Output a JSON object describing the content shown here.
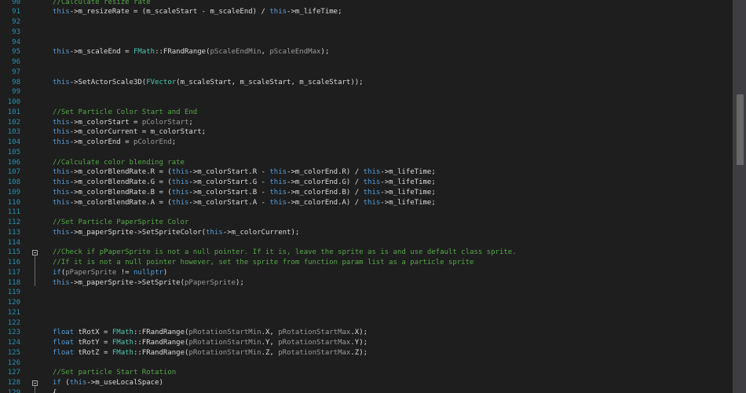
{
  "colors": {
    "background": "#1e1e1e",
    "line_number": "#2b91af",
    "comment": "#57a64a",
    "keyword": "#569cd6",
    "member": "#dcdcdc",
    "class": "#4ec9b0",
    "function": "#dcdcaa",
    "param": "#9a9a9a",
    "default": "#dcdcdc"
  },
  "editor": {
    "lines": [
      {
        "n": "90",
        "tokens": [
          {
            "t": "//Calculate resize rate",
            "c": "comment"
          }
        ]
      },
      {
        "n": "91",
        "tokens": [
          {
            "t": "this",
            "c": "keyword"
          },
          {
            "t": "->m_resizeRate = (m_scaleStart - m_scaleEnd) / ",
            "c": "default"
          },
          {
            "t": "this",
            "c": "keyword"
          },
          {
            "t": "->m_lifeTime;",
            "c": "default"
          }
        ]
      },
      {
        "n": "92",
        "tokens": []
      },
      {
        "n": "93",
        "tokens": []
      },
      {
        "n": "94",
        "tokens": []
      },
      {
        "n": "95",
        "tokens": [
          {
            "t": "this",
            "c": "keyword"
          },
          {
            "t": "->m_scaleEnd = ",
            "c": "default"
          },
          {
            "t": "FMath",
            "c": "class"
          },
          {
            "t": "::FRandRange(",
            "c": "default"
          },
          {
            "t": "pScaleEndMin",
            "c": "param"
          },
          {
            "t": ", ",
            "c": "default"
          },
          {
            "t": "pScaleEndMax",
            "c": "param"
          },
          {
            "t": ");",
            "c": "default"
          }
        ]
      },
      {
        "n": "96",
        "tokens": []
      },
      {
        "n": "97",
        "tokens": []
      },
      {
        "n": "98",
        "tokens": [
          {
            "t": "this",
            "c": "keyword"
          },
          {
            "t": "->SetActorScale3D(",
            "c": "default"
          },
          {
            "t": "FVector",
            "c": "class"
          },
          {
            "t": "(m_scaleStart, m_scaleStart, m_scaleStart));",
            "c": "default"
          }
        ]
      },
      {
        "n": "99",
        "tokens": []
      },
      {
        "n": "100",
        "tokens": []
      },
      {
        "n": "101",
        "tokens": [
          {
            "t": "//Set Particle Color Start and End",
            "c": "comment"
          }
        ]
      },
      {
        "n": "102",
        "tokens": [
          {
            "t": "this",
            "c": "keyword"
          },
          {
            "t": "->m_colorStart = ",
            "c": "default"
          },
          {
            "t": "pColorStart",
            "c": "param"
          },
          {
            "t": ";",
            "c": "default"
          }
        ]
      },
      {
        "n": "103",
        "tokens": [
          {
            "t": "this",
            "c": "keyword"
          },
          {
            "t": "->m_colorCurrent = m_colorStart;",
            "c": "default"
          }
        ]
      },
      {
        "n": "104",
        "tokens": [
          {
            "t": "this",
            "c": "keyword"
          },
          {
            "t": "->m_colorEnd = ",
            "c": "default"
          },
          {
            "t": "pColorEnd",
            "c": "param"
          },
          {
            "t": ";",
            "c": "default"
          }
        ]
      },
      {
        "n": "105",
        "tokens": []
      },
      {
        "n": "106",
        "tokens": [
          {
            "t": "//Calculate color blending rate",
            "c": "comment"
          }
        ]
      },
      {
        "n": "107",
        "tokens": [
          {
            "t": "this",
            "c": "keyword"
          },
          {
            "t": "->m_colorBlendRate.R = (",
            "c": "default"
          },
          {
            "t": "this",
            "c": "keyword"
          },
          {
            "t": "->m_colorStart.R - ",
            "c": "default"
          },
          {
            "t": "this",
            "c": "keyword"
          },
          {
            "t": "->m_colorEnd.R) / ",
            "c": "default"
          },
          {
            "t": "this",
            "c": "keyword"
          },
          {
            "t": "->m_lifeTime;",
            "c": "default"
          }
        ]
      },
      {
        "n": "108",
        "tokens": [
          {
            "t": "this",
            "c": "keyword"
          },
          {
            "t": "->m_colorBlendRate.G = (",
            "c": "default"
          },
          {
            "t": "this",
            "c": "keyword"
          },
          {
            "t": "->m_colorStart.G - ",
            "c": "default"
          },
          {
            "t": "this",
            "c": "keyword"
          },
          {
            "t": "->m_colorEnd.G) / ",
            "c": "default"
          },
          {
            "t": "this",
            "c": "keyword"
          },
          {
            "t": "->m_lifeTime;",
            "c": "default"
          }
        ]
      },
      {
        "n": "109",
        "tokens": [
          {
            "t": "this",
            "c": "keyword"
          },
          {
            "t": "->m_colorBlendRate.B = (",
            "c": "default"
          },
          {
            "t": "this",
            "c": "keyword"
          },
          {
            "t": "->m_colorStart.B - ",
            "c": "default"
          },
          {
            "t": "this",
            "c": "keyword"
          },
          {
            "t": "->m_colorEnd.B) / ",
            "c": "default"
          },
          {
            "t": "this",
            "c": "keyword"
          },
          {
            "t": "->m_lifeTime;",
            "c": "default"
          }
        ]
      },
      {
        "n": "110",
        "tokens": [
          {
            "t": "this",
            "c": "keyword"
          },
          {
            "t": "->m_colorBlendRate.A = (",
            "c": "default"
          },
          {
            "t": "this",
            "c": "keyword"
          },
          {
            "t": "->m_colorStart.A - ",
            "c": "default"
          },
          {
            "t": "this",
            "c": "keyword"
          },
          {
            "t": "->m_colorEnd.A) / ",
            "c": "default"
          },
          {
            "t": "this",
            "c": "keyword"
          },
          {
            "t": "->m_lifeTime;",
            "c": "default"
          }
        ]
      },
      {
        "n": "111",
        "tokens": []
      },
      {
        "n": "112",
        "tokens": [
          {
            "t": "//Set Particle PaperSprite Color",
            "c": "comment"
          }
        ]
      },
      {
        "n": "113",
        "tokens": [
          {
            "t": "this",
            "c": "keyword"
          },
          {
            "t": "->m_paperSprite->SetSpriteColor(",
            "c": "default"
          },
          {
            "t": "this",
            "c": "keyword"
          },
          {
            "t": "->m_colorCurrent);",
            "c": "default"
          }
        ]
      },
      {
        "n": "114",
        "tokens": []
      },
      {
        "n": "115",
        "tokens": [
          {
            "t": "//Check if pPaperSprite is not a null pointer. If it is, leave the sprite as is and use default class sprite.",
            "c": "comment"
          }
        ]
      },
      {
        "n": "116",
        "tokens": [
          {
            "t": "//If it is not a null pointer however, set the sprite from function param list as a particle sprite",
            "c": "comment"
          }
        ]
      },
      {
        "n": "117",
        "tokens": [
          {
            "t": "if",
            "c": "keyword"
          },
          {
            "t": "(",
            "c": "default"
          },
          {
            "t": "pPaperSprite",
            "c": "param"
          },
          {
            "t": " != ",
            "c": "default"
          },
          {
            "t": "nullptr",
            "c": "keyword"
          },
          {
            "t": ")",
            "c": "default"
          }
        ]
      },
      {
        "n": "118",
        "tokens": [
          {
            "t": "this",
            "c": "keyword"
          },
          {
            "t": "->m_paperSprite->SetSprite(",
            "c": "default"
          },
          {
            "t": "pPaperSprite",
            "c": "param"
          },
          {
            "t": ");",
            "c": "default"
          }
        ]
      },
      {
        "n": "119",
        "tokens": []
      },
      {
        "n": "120",
        "tokens": []
      },
      {
        "n": "121",
        "tokens": []
      },
      {
        "n": "122",
        "tokens": []
      },
      {
        "n": "123",
        "tokens": [
          {
            "t": "float",
            "c": "keyword"
          },
          {
            "t": " tRotX = ",
            "c": "default"
          },
          {
            "t": "FMath",
            "c": "class"
          },
          {
            "t": "::FRandRange(",
            "c": "default"
          },
          {
            "t": "pRotationStartMin",
            "c": "param"
          },
          {
            "t": ".X, ",
            "c": "default"
          },
          {
            "t": "pRotationStartMax",
            "c": "param"
          },
          {
            "t": ".X);",
            "c": "default"
          }
        ]
      },
      {
        "n": "124",
        "tokens": [
          {
            "t": "float",
            "c": "keyword"
          },
          {
            "t": " tRotY = ",
            "c": "default"
          },
          {
            "t": "FMath",
            "c": "class"
          },
          {
            "t": "::FRandRange(",
            "c": "default"
          },
          {
            "t": "pRotationStartMin",
            "c": "param"
          },
          {
            "t": ".Y, ",
            "c": "default"
          },
          {
            "t": "pRotationStartMax",
            "c": "param"
          },
          {
            "t": ".Y);",
            "c": "default"
          }
        ]
      },
      {
        "n": "125",
        "tokens": [
          {
            "t": "float",
            "c": "keyword"
          },
          {
            "t": " tRotZ = ",
            "c": "default"
          },
          {
            "t": "FMath",
            "c": "class"
          },
          {
            "t": "::FRandRange(",
            "c": "default"
          },
          {
            "t": "pRotationStartMin",
            "c": "param"
          },
          {
            "t": ".Z, ",
            "c": "default"
          },
          {
            "t": "pRotationStartMax",
            "c": "param"
          },
          {
            "t": ".Z);",
            "c": "default"
          }
        ]
      },
      {
        "n": "126",
        "tokens": []
      },
      {
        "n": "127",
        "tokens": [
          {
            "t": "//Set particle Start Rotation",
            "c": "comment"
          }
        ]
      },
      {
        "n": "128",
        "tokens": [
          {
            "t": "if",
            "c": "keyword"
          },
          {
            "t": " (",
            "c": "default"
          },
          {
            "t": "this",
            "c": "keyword"
          },
          {
            "t": "->m_useLocalSpace)",
            "c": "default"
          }
        ]
      },
      {
        "n": "129",
        "tokens": [
          {
            "t": "{",
            "c": "default"
          }
        ]
      }
    ],
    "fold_lines": [
      "115",
      "128"
    ]
  }
}
